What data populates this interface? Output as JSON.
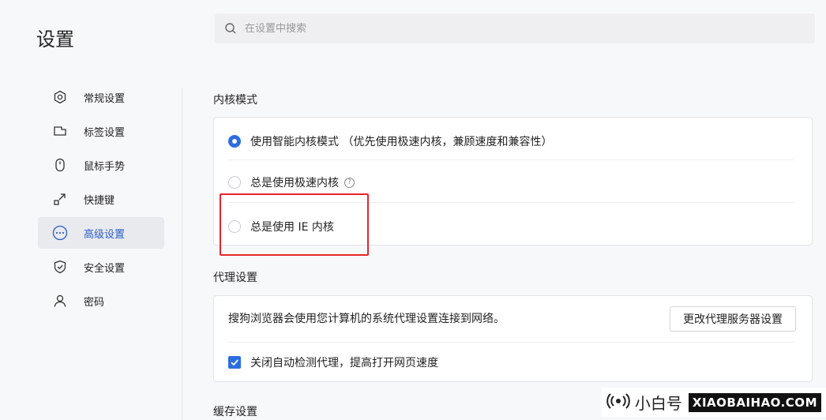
{
  "header": {
    "title": "设置",
    "search_placeholder": "在设置中搜索"
  },
  "sidebar": {
    "items": [
      {
        "label": "常规设置",
        "icon": "general-settings-icon",
        "active": false
      },
      {
        "label": "标签设置",
        "icon": "tab-icon",
        "active": false
      },
      {
        "label": "鼠标手势",
        "icon": "mouse-icon",
        "active": false
      },
      {
        "label": "快捷键",
        "icon": "shortcut-icon",
        "active": false
      },
      {
        "label": "高级设置",
        "icon": "more-icon",
        "active": true
      },
      {
        "label": "安全设置",
        "icon": "shield-icon",
        "active": false
      },
      {
        "label": "密码",
        "icon": "user-icon",
        "active": false
      }
    ]
  },
  "kernel": {
    "title": "内核模式",
    "options": [
      {
        "label": "使用智能内核模式 （优先使用极速内核，兼顾速度和兼容性）",
        "checked": true
      },
      {
        "label": "总是使用极速内核",
        "checked": false
      },
      {
        "label": "总是使用 IE 内核",
        "checked": false
      }
    ]
  },
  "proxy": {
    "title": "代理设置",
    "description": "搜狗浏览器会使用您计算机的系统代理设置连接到网络。",
    "button_label": "更改代理服务器设置",
    "auto_detect_label": "关闭自动检测代理，提高打开网页速度",
    "auto_detect_checked": true
  },
  "cache": {
    "title": "缓存设置"
  },
  "watermark": {
    "name": "小白号",
    "domain": "XIAOBAIHAO.COM"
  },
  "colors": {
    "accent": "#2b6ee0",
    "highlight": "#e5252b"
  }
}
